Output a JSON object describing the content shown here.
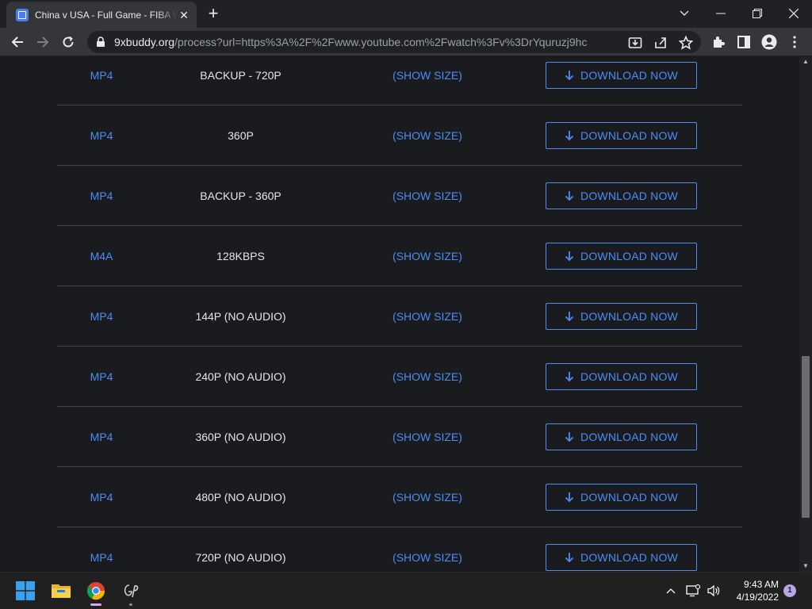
{
  "browser": {
    "tab_title": "China v USA - Full Game - FIBA Women's",
    "url_domain": "9xbuddy.org",
    "url_path": "/process?url=https%3A%2F%2Fwww.youtube.com%2Fwatch%3Fv%3DrYquruzj9hc"
  },
  "rows": [
    {
      "format": "MP4",
      "quality": "BACKUP - 720P",
      "size": "(SHOW SIZE)",
      "button": "DOWNLOAD NOW"
    },
    {
      "format": "MP4",
      "quality": "360P",
      "size": "(SHOW SIZE)",
      "button": "DOWNLOAD NOW"
    },
    {
      "format": "MP4",
      "quality": "BACKUP - 360P",
      "size": "(SHOW SIZE)",
      "button": "DOWNLOAD NOW"
    },
    {
      "format": "M4A",
      "quality": "128KBPS",
      "size": "(SHOW SIZE)",
      "button": "DOWNLOAD NOW"
    },
    {
      "format": "MP4",
      "quality": "144P (NO AUDIO)",
      "size": "(SHOW SIZE)",
      "button": "DOWNLOAD NOW"
    },
    {
      "format": "MP4",
      "quality": "240P (NO AUDIO)",
      "size": "(SHOW SIZE)",
      "button": "DOWNLOAD NOW"
    },
    {
      "format": "MP4",
      "quality": "360P (NO AUDIO)",
      "size": "(SHOW SIZE)",
      "button": "DOWNLOAD NOW"
    },
    {
      "format": "MP4",
      "quality": "480P (NO AUDIO)",
      "size": "(SHOW SIZE)",
      "button": "DOWNLOAD NOW"
    },
    {
      "format": "MP4",
      "quality": "720P (NO AUDIO)",
      "size": "(SHOW SIZE)",
      "button": "DOWNLOAD NOW"
    }
  ],
  "taskbar": {
    "time": "9:43 AM",
    "date": "4/19/2022",
    "notifications": "1"
  },
  "colors": {
    "accent": "#4c8cf5",
    "page_bg": "#1a1b1e",
    "divider": "#3f4146"
  }
}
